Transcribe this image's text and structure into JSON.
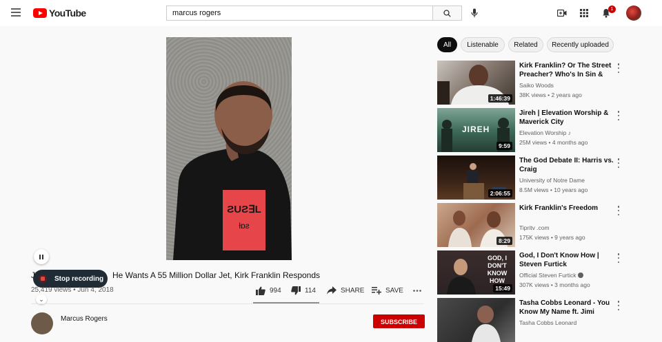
{
  "header": {
    "logo_text": "YouTube",
    "search_value": "marcus rogers",
    "notification_count": "1"
  },
  "overlay": {
    "stop_recording_label": "Stop recording"
  },
  "video": {
    "title_fragment_left": "J",
    "title_fragment_right": "He Wants A 55 Million Dollar Jet, Kirk Franklin Responds",
    "views_date": "25,419 views • Jun 4, 2018",
    "likes": "994",
    "dislikes": "114",
    "share_label": "SHARE",
    "save_label": "SAVE",
    "channel_name": "Marcus Rogers",
    "subscribe_label": "SUBSCRIBE"
  },
  "chips": [
    {
      "label": "All",
      "active": true
    },
    {
      "label": "Listenable",
      "active": false
    },
    {
      "label": "Related",
      "active": false
    },
    {
      "label": "Recently uploaded",
      "active": false
    }
  ],
  "recommendations": [
    {
      "title": "Kirk Franklin? Or The Street Preacher? Who's In Sin & Nee...",
      "channel": "Saiko Woods",
      "meta": "38K views • 2 years ago",
      "duration": "1:46:39",
      "thumb_color": "#6a5c55"
    },
    {
      "title": "Jireh | Elevation Worship & Maverick City",
      "channel": "Elevation Worship",
      "meta": "25M views • 4 months ago",
      "duration": "9:59",
      "thumb_color": "#3f6c5a",
      "thumb_text": "JIREH",
      "badge": "music-note-icon"
    },
    {
      "title": "The God Debate II: Harris vs. Craig",
      "channel": "University of Notre Dame",
      "meta": "8.5M views • 10 years ago",
      "duration": "2:06:55",
      "thumb_color": "#3a2418"
    },
    {
      "title": "Kirk Franklin's Freedom",
      "channel": "Tipritv .com",
      "meta": "175K views • 9 years ago",
      "duration": "8:29",
      "thumb_color": "#9d6a4f"
    },
    {
      "title": "God, I Don't Know How | Steven Furtick",
      "channel": "Official Steven Furtick",
      "meta": "307K views • 3 months ago",
      "duration": "15:49",
      "thumb_color": "#2c2324",
      "thumb_text": "GOD, I DON'T KNOW HOW",
      "badge": "verified-icon"
    },
    {
      "title": "Tasha Cobbs Leonard - You Know My Name ft. Jimi Cravity",
      "channel": "Tasha Cobbs Leonard",
      "meta": "",
      "duration": "",
      "thumb_color": "#2d2d2d"
    }
  ]
}
